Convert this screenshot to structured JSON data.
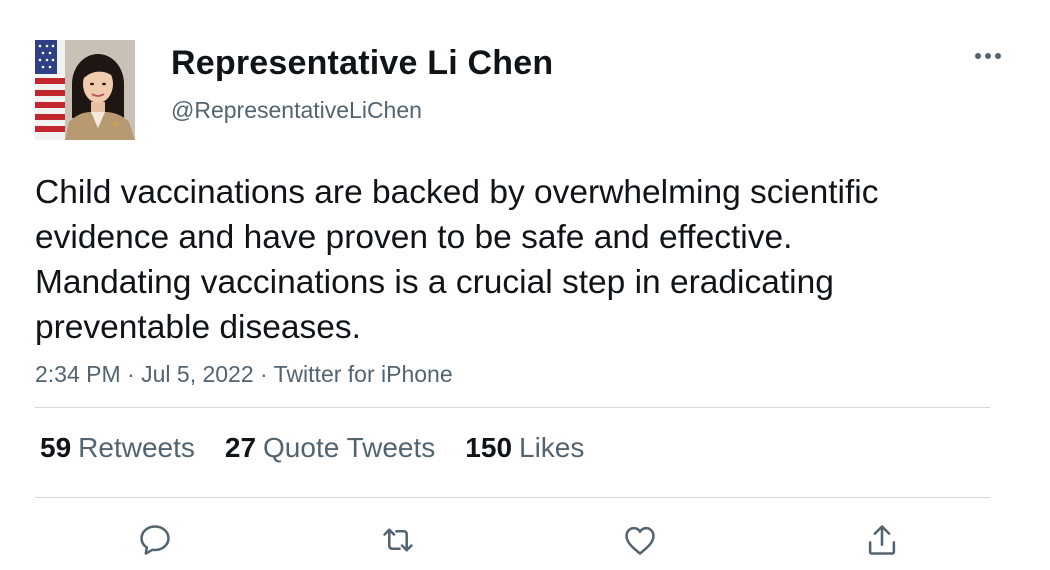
{
  "author": {
    "display_name": "Representative Li Chen",
    "handle": "@RepresentativeLiChen",
    "avatar_icon": "profile-photo-with-flag"
  },
  "tweet": {
    "text": "Child vaccinations are backed by overwhelming scientific evidence and have proven to be safe and effective. Mandating vaccinations is a crucial step in eradicating preventable diseases.",
    "time": "2:34 PM",
    "separator": " · ",
    "date": "Jul 5, 2022",
    "source": "Twitter for iPhone"
  },
  "stats": {
    "retweets_count": "59",
    "retweets_label": "Retweets",
    "quotes_count": "27",
    "quotes_label": "Quote Tweets",
    "likes_count": "150",
    "likes_label": "Likes"
  },
  "actions": [
    "reply-icon",
    "retweet-icon",
    "like-icon",
    "share-icon"
  ],
  "more_icon": "more-horizontal-icon",
  "colors": {
    "text_primary": "#0f1419",
    "text_secondary": "#536471",
    "divider": "#cfd9de",
    "icon": "#536471"
  }
}
